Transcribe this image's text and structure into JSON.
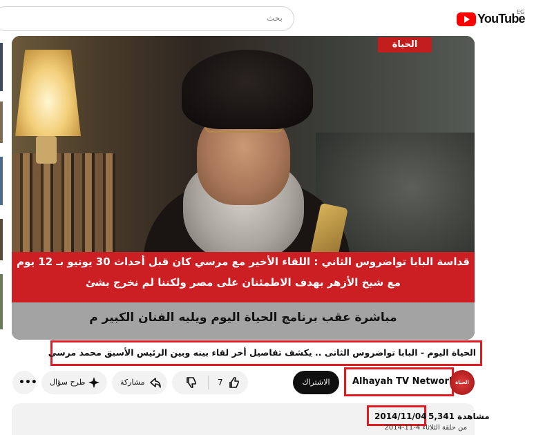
{
  "header": {
    "search_placeholder": "بحث",
    "logo_text": "YouTube",
    "region_code": "EG"
  },
  "video": {
    "channel_logo_text": "الحياة",
    "banner_line1": "قداسة البابا تواضروس الثاني : اللقاء الأخير مع مرسي كان قبل أحداث 30 يونيو بـ 12 يوم",
    "banner_line2": "مع شيخ الأزهر بهدف الاطمئنان على مصر ولكننا لم نخرج بشئ",
    "ticker": "مباشرة عقب برنامج الحياة اليوم ويليه الفنان الكبير م"
  },
  "title": "الحياة اليوم - البابا تواضروس الثانى .. يكشف تفاصيل أخر لقاء بينه وبين الرئيس الأسبق محمد مرسى",
  "channel": {
    "name": "Alhayah TV Network",
    "subscribe_label": "الاشتراك",
    "avatar_text": "الحياة"
  },
  "actions": {
    "more_label": "•••",
    "ask_label": "طرح سؤال",
    "share_label": "مشاركة",
    "like_count": "7"
  },
  "description": {
    "views": "5,341 مشاهدة",
    "date": "2014/11/04",
    "line": "من حلقة الثلاثاء 4-11-2014"
  },
  "colors": {
    "highlight_red": "#e11b22",
    "banner_red": "#cc1f23",
    "youtube_red": "#ff0000"
  }
}
